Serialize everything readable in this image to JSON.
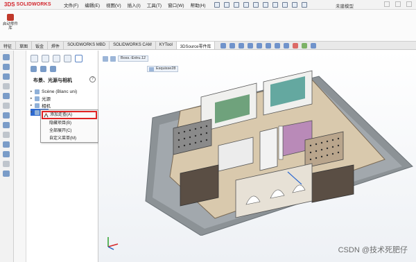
{
  "app": {
    "logo_text": "SOLIDWORKS",
    "logo_mark": "3DS",
    "document_title": "未建模型"
  },
  "menu": {
    "items": [
      "文件(F)",
      "编辑(E)",
      "视图(V)",
      "插入(I)",
      "工具(T)",
      "窗口(W)",
      "帮助(H)"
    ]
  },
  "command": {
    "button_label": "启动零件库"
  },
  "tabs": {
    "items": [
      "特征",
      "草图",
      "钣金",
      "焊件",
      "SOUDWORKS MBD",
      "SOLIDWORKS CAM",
      "KYTool",
      "3DSource零件库"
    ],
    "active_index": 7
  },
  "panel": {
    "title": "布景、光源与相机",
    "help": "?",
    "tree": [
      {
        "label": "Scène (Blanc uni)"
      },
      {
        "label": "光源"
      },
      {
        "label": "相机"
      }
    ]
  },
  "context_menu": {
    "items": [
      "添加走查(A)",
      "隐藏项目(B)",
      "全部展开(C)",
      "自定义菜单(M)"
    ],
    "highlighted_index": 0
  },
  "viewport": {
    "breadcrumb_feature": "Boss.-Extru.12",
    "sketch_chip": "Esquisse28"
  },
  "watermark": "CSDN @技术死肥仔",
  "colors": {
    "accent_blue": "#2e6ad1",
    "highlight_red": "#e02222",
    "logo_red": "#d2232a"
  }
}
